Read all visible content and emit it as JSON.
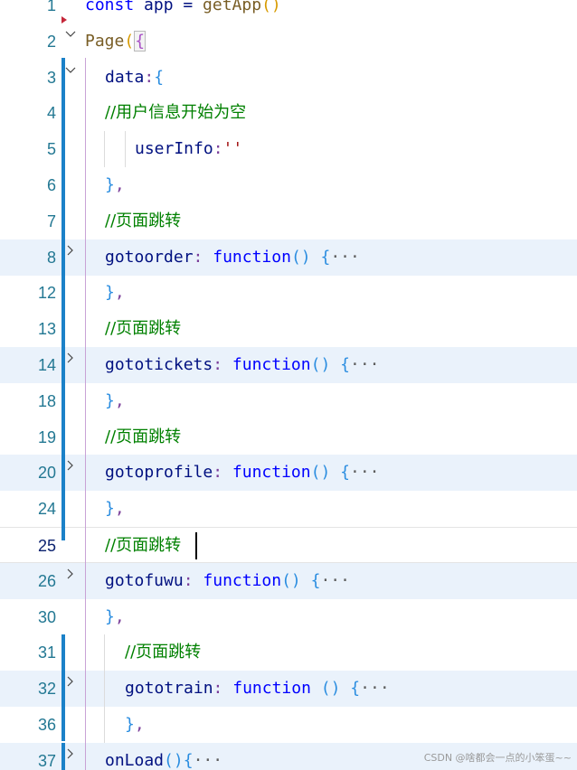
{
  "editor": {
    "lines": [
      {
        "number": "1",
        "tokens": [
          {
            "t": "const",
            "c": "kw"
          },
          {
            "t": " app = ",
            "c": "prop"
          },
          {
            "t": "getApp",
            "c": "fn"
          },
          {
            "t": "()",
            "c": "br1"
          }
        ]
      },
      {
        "number": "2",
        "tokens": [
          {
            "t": "Page",
            "c": "fn"
          },
          {
            "t": "(",
            "c": "br1"
          },
          {
            "t": "{",
            "c": "br2 fbox"
          }
        ]
      },
      {
        "number": "3",
        "tokens": [
          {
            "t": "data",
            "c": "prop"
          },
          {
            "t": ":",
            "c": "pu"
          },
          {
            "t": "{",
            "c": "br3"
          }
        ]
      },
      {
        "number": "4",
        "tokens": [
          {
            "t": "//用户信息开始为空",
            "c": "cm"
          }
        ]
      },
      {
        "number": "5",
        "tokens": [
          {
            "t": "userInfo",
            "c": "prop"
          },
          {
            "t": ":",
            "c": "pu"
          },
          {
            "t": "''",
            "c": "str"
          }
        ]
      },
      {
        "number": "6",
        "tokens": [
          {
            "t": "}",
            "c": "br3"
          },
          {
            "t": ",",
            "c": "pu"
          }
        ]
      },
      {
        "number": "7",
        "tokens": [
          {
            "t": "//页面跳转",
            "c": "cm"
          }
        ]
      },
      {
        "number": "8",
        "tokens": [
          {
            "t": "gotoorder",
            "c": "prop"
          },
          {
            "t": ": ",
            "c": "pu"
          },
          {
            "t": "function",
            "c": "kw"
          },
          {
            "t": "()",
            "c": "br3"
          },
          {
            "t": " ",
            "c": "pu"
          },
          {
            "t": "{",
            "c": "br3"
          },
          {
            "t": "···",
            "c": "ell"
          }
        ]
      },
      {
        "number": "12",
        "tokens": [
          {
            "t": "}",
            "c": "br3"
          },
          {
            "t": ",",
            "c": "pu"
          }
        ]
      },
      {
        "number": "13",
        "tokens": [
          {
            "t": "//页面跳转",
            "c": "cm"
          }
        ]
      },
      {
        "number": "14",
        "tokens": [
          {
            "t": "gototickets",
            "c": "prop"
          },
          {
            "t": ": ",
            "c": "pu"
          },
          {
            "t": "function",
            "c": "kw"
          },
          {
            "t": "()",
            "c": "br3"
          },
          {
            "t": " ",
            "c": "pu"
          },
          {
            "t": "{",
            "c": "br3"
          },
          {
            "t": "···",
            "c": "ell"
          }
        ]
      },
      {
        "number": "18",
        "tokens": [
          {
            "t": "}",
            "c": "br3"
          },
          {
            "t": ",",
            "c": "pu"
          }
        ]
      },
      {
        "number": "19",
        "tokens": [
          {
            "t": "//页面跳转",
            "c": "cm"
          }
        ]
      },
      {
        "number": "20",
        "tokens": [
          {
            "t": "gotoprofile",
            "c": "prop"
          },
          {
            "t": ": ",
            "c": "pu"
          },
          {
            "t": "function",
            "c": "kw"
          },
          {
            "t": "()",
            "c": "br3"
          },
          {
            "t": " ",
            "c": "pu"
          },
          {
            "t": "{",
            "c": "br3"
          },
          {
            "t": "···",
            "c": "ell"
          }
        ]
      },
      {
        "number": "24",
        "tokens": [
          {
            "t": "}",
            "c": "br3"
          },
          {
            "t": ",",
            "c": "pu"
          }
        ]
      },
      {
        "number": "25",
        "tokens": [
          {
            "t": "//页面跳转",
            "c": "cm"
          }
        ]
      },
      {
        "number": "26",
        "tokens": [
          {
            "t": "gotofuwu",
            "c": "prop"
          },
          {
            "t": ": ",
            "c": "pu"
          },
          {
            "t": "function",
            "c": "kw"
          },
          {
            "t": "()",
            "c": "br3"
          },
          {
            "t": " ",
            "c": "pu"
          },
          {
            "t": "{",
            "c": "br3"
          },
          {
            "t": "···",
            "c": "ell"
          }
        ]
      },
      {
        "number": "30",
        "tokens": [
          {
            "t": "}",
            "c": "br3"
          },
          {
            "t": ",",
            "c": "pu"
          }
        ]
      },
      {
        "number": "31",
        "tokens": [
          {
            "t": "//页面跳转",
            "c": "cm"
          }
        ]
      },
      {
        "number": "32",
        "tokens": [
          {
            "t": "gototrain",
            "c": "prop"
          },
          {
            "t": ": ",
            "c": "pu"
          },
          {
            "t": "function",
            "c": "kw"
          },
          {
            "t": " ()",
            "c": "br3"
          },
          {
            "t": " ",
            "c": "pu"
          },
          {
            "t": "{",
            "c": "br3"
          },
          {
            "t": "···",
            "c": "ell"
          }
        ]
      },
      {
        "number": "36",
        "tokens": [
          {
            "t": "}",
            "c": "br3"
          },
          {
            "t": ",",
            "c": "pu"
          }
        ]
      },
      {
        "number": "37",
        "tokens": [
          {
            "t": "onLoad",
            "c": "prop"
          },
          {
            "t": "()",
            "c": "br3"
          },
          {
            "t": "{",
            "c": "br3"
          },
          {
            "t": "···",
            "c": "ell"
          }
        ]
      }
    ],
    "cursor_line": "25",
    "colors": {
      "line_number": "#237893",
      "keyword": "#0000ff",
      "comment": "#008000",
      "property": "#001080",
      "function": "#795e26",
      "highlight": "#eaf2fb",
      "modified_bar": "#1b81c8"
    }
  },
  "watermark": "CSDN @啥都会一点的小笨蛋~~"
}
